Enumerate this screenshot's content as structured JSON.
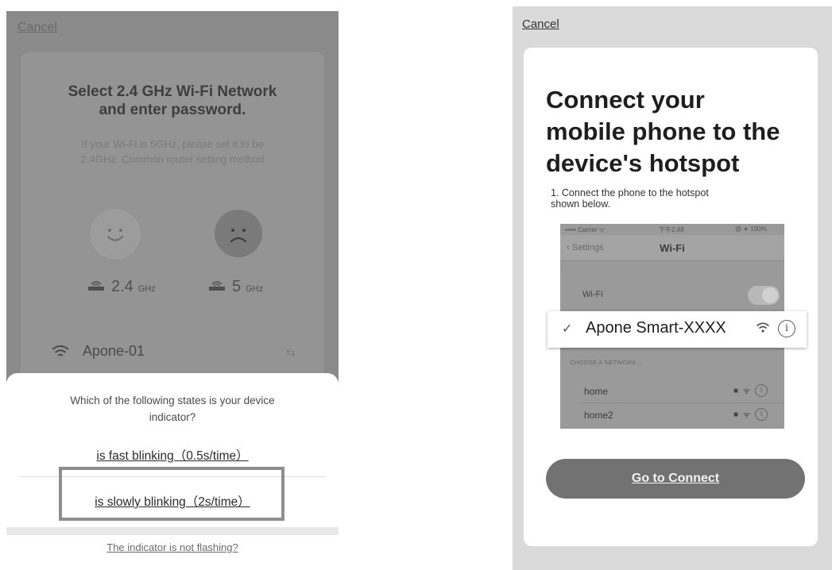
{
  "left": {
    "cancel": "Cancel",
    "title_line1": "Select 2.4 GHz Wi-Fi Network",
    "title_line2": "and enter password.",
    "desc_line1": "If your Wi-Fi is 5GHz, please set it to be",
    "desc_line2": "2.4GHz. Common router setting method",
    "band_24": "2.4",
    "band_24_unit": "GHz",
    "band_5": "5",
    "band_5_unit": "GHz",
    "wifi_name": "Apone-01",
    "sheet": {
      "question_line1": "Which of the following states is your device",
      "question_line2": "indicator?",
      "option_fast": "is fast blinking（0.5s/time）",
      "option_slow": "is slowly blinking（2s/time）",
      "not_flashing": "The indicator is not flashing?"
    }
  },
  "right": {
    "cancel": "Cancel",
    "title_line1": "Connect your",
    "title_line2": "mobile phone to the",
    "title_line3": "device's hotspot",
    "step_line1": "1. Connect the phone to the hotspot",
    "step_line2": "shown below.",
    "phone": {
      "carrier": "••••• Carrier ᯤ",
      "time": "下午2:48",
      "battery": "@ ∗ 100%",
      "back_label": "Settings",
      "nav_title": "Wi-Fi",
      "wifi_label": "Wi-Fi",
      "hotspot_name": "Apone Smart-XXXX",
      "choose_network": "CHOOSE A NETWORK...",
      "networks": [
        {
          "name": "home"
        },
        {
          "name": "home2"
        }
      ]
    },
    "connect_button": "Go to Connect"
  },
  "colors": {
    "overlay": "#8a8a8a",
    "button": "#727272",
    "right_background": "#dadada"
  }
}
